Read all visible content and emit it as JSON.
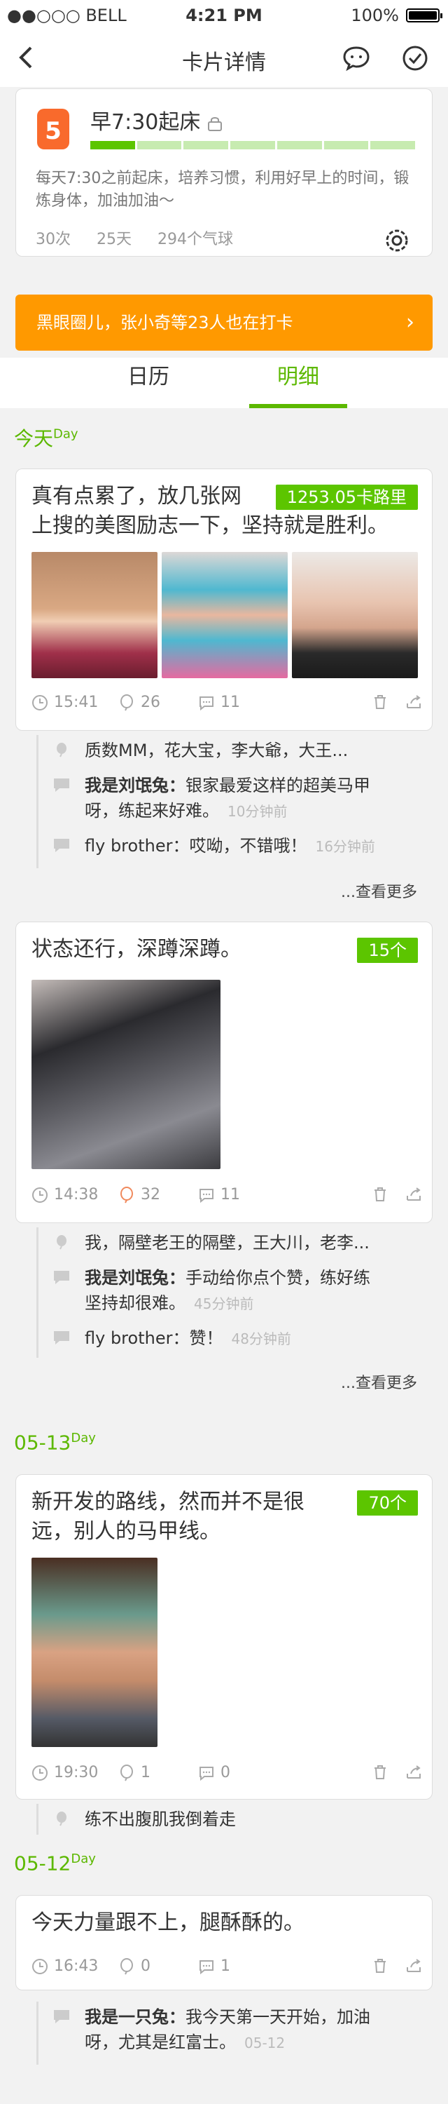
{
  "status_bar": {
    "carrier": "●●○○○ BELL",
    "time": "4:21 PM",
    "battery": "100%"
  },
  "nav": {
    "title": "卡片详情"
  },
  "card_info": {
    "icon_number": "5",
    "goal": "早7:30起床",
    "progress_segments_filled": 1,
    "progress_segments_total": 7,
    "description": "每天7:30之前起床，培养习惯，利用好早上的时间，锻炼身体，加油加油～",
    "stats": [
      "30次",
      "25天",
      "294个气球"
    ]
  },
  "circle_banner": {
    "text": "黑眼圈儿，张小奇等23人也在打卡"
  },
  "tabs": [
    {
      "label": "日历"
    },
    {
      "label": "明细"
    }
  ],
  "days": [
    {
      "label": "今天",
      "sup": "Day"
    },
    {
      "label": "05-13",
      "sup": "Day"
    },
    {
      "label": "05-12",
      "sup": "Day"
    }
  ],
  "posts": [
    {
      "text_line1": "真有点累了，放几张网",
      "text_line2": "上搜的美图励志一下，坚持就是胜利。",
      "badge": "1253.05卡路里",
      "time": "15:41",
      "likes": "26",
      "comments": "11",
      "comment_list": [
        {
          "who": "质数MM，花大宝，李大爺，大王...",
          "text": "",
          "time": ""
        },
        {
          "who": "我是刘氓兔：",
          "text": "银家最爱这样的超美马甲",
          "text2": "呀，练起来好难。",
          "time": "10分钟前"
        },
        {
          "who": "fly brother：",
          "text": "哎呦，不错哦！",
          "time": "16分钟前"
        }
      ],
      "more": "...查看更多"
    },
    {
      "text_line1": "状态还行，深蹲深蹲。",
      "badge": "15个",
      "time": "14:38",
      "likes": "32",
      "comments": "11",
      "comment_list": [
        {
          "who": "我，隔壁老王的隔壁，王大川，老李...",
          "text": "",
          "time": ""
        },
        {
          "who": "我是刘氓兔：",
          "text": "手动给你点个赞，练好练",
          "text2": "坚持却很难。",
          "time": "45分钟前"
        },
        {
          "who": "fly brother：",
          "text": "赞！",
          "time": "48分钟前"
        }
      ],
      "more": "...查看更多"
    },
    {
      "text_line1": "新开发的路线，然而并不是很",
      "text_line2": "远，别人的马甲线。",
      "badge": "70个",
      "time": "19:30",
      "likes": "1",
      "comments": "0",
      "comment_list": [
        {
          "who": "练不出腹肌我倒着走",
          "text": "",
          "time": ""
        }
      ]
    },
    {
      "text_line1": "今天力量跟不上，腿酥酥的。",
      "time": "16:43",
      "likes": "0",
      "comments": "1",
      "comment_list": [
        {
          "who": "我是一只兔：",
          "text": "我今天第一天开始，加油",
          "text2": "呀，尤其是红富士。",
          "time": "05-12"
        }
      ]
    }
  ]
}
